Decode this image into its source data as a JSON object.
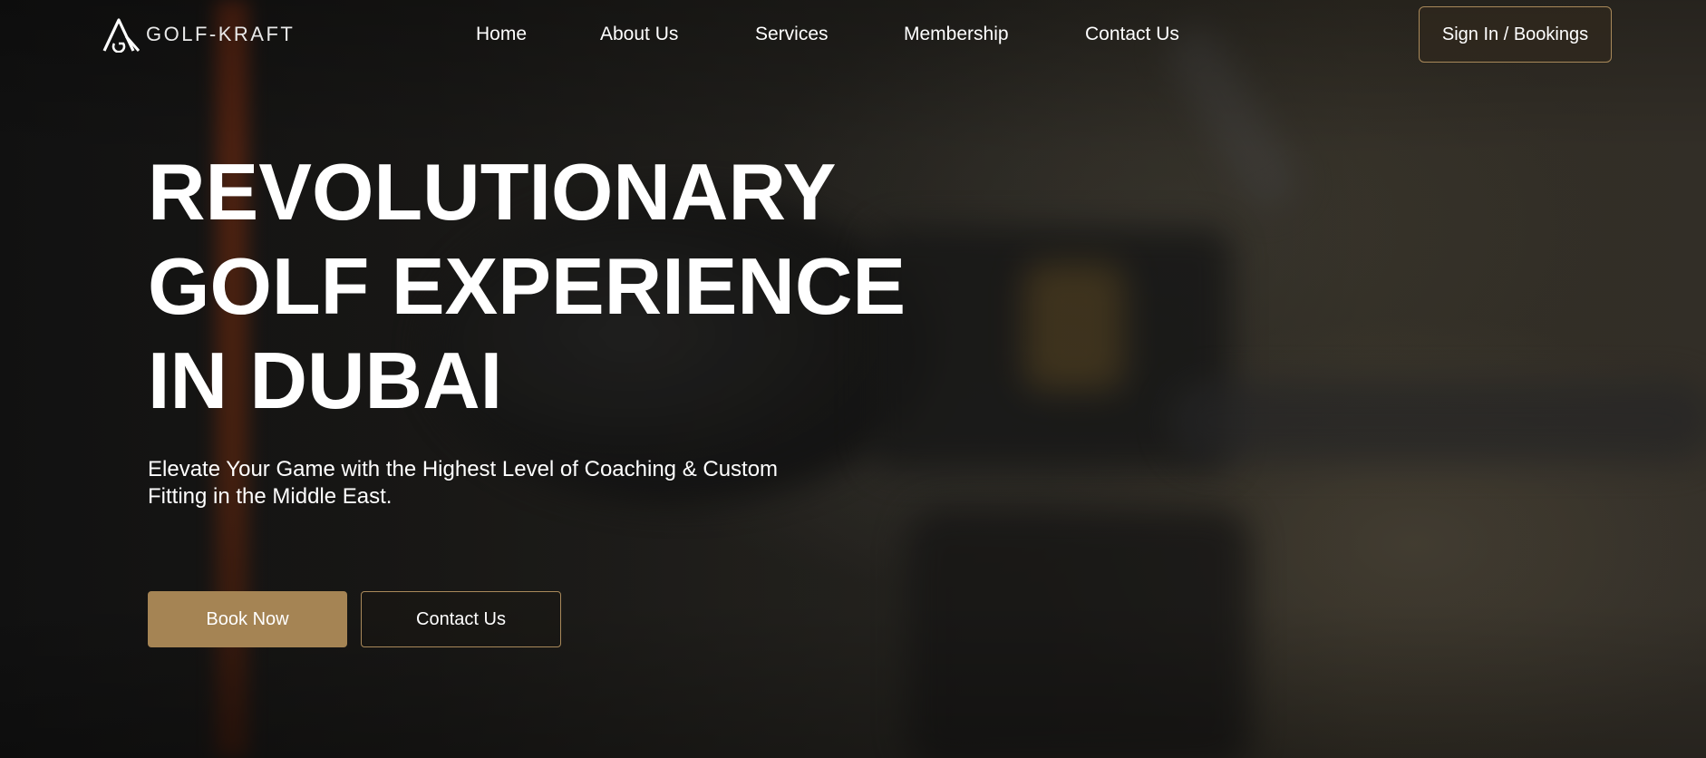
{
  "header": {
    "logo_text": "GOLF-KRAFT",
    "logo_icon": "golf-kraft-logo-mark",
    "nav": [
      {
        "label": "Home"
      },
      {
        "label": "About Us"
      },
      {
        "label": "Services"
      },
      {
        "label": "Membership"
      },
      {
        "label": "Contact Us"
      }
    ],
    "signin_label": "Sign In / Bookings"
  },
  "hero": {
    "title_line1": "REVOLUTIONARY",
    "title_line2": "GOLF EXPERIENCE",
    "title_line3": "IN DUBAI",
    "subtitle_line1": "Elevate Your Game with the Highest Level of Coaching & Custom",
    "subtitle_line2": "Fitting in the Middle East.",
    "primary_button": "Book Now",
    "secondary_button": "Contact Us"
  },
  "colors": {
    "accent_gold": "#a58454",
    "button_border": "#a9895a",
    "text": "#ffffff",
    "background_dark": "#1d1c1a"
  }
}
